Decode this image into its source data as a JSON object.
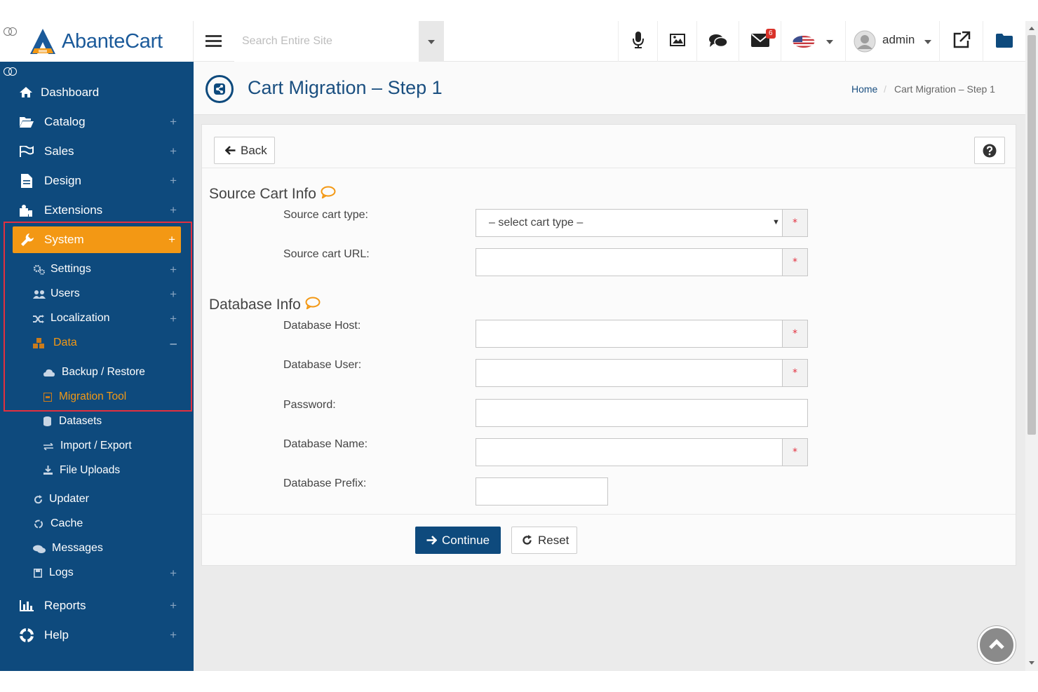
{
  "app": {
    "brand": "AbanteCart"
  },
  "topbar": {
    "search_placeholder": "Search Entire Site",
    "messages_badge": "6",
    "user_name": "admin"
  },
  "sidebar": {
    "items": [
      {
        "label": "Dashboard",
        "icon": "home-icon"
      },
      {
        "label": "Catalog",
        "icon": "folder-open-icon"
      },
      {
        "label": "Sales",
        "icon": "flag-icon"
      },
      {
        "label": "Design",
        "icon": "file-icon"
      },
      {
        "label": "Extensions",
        "icon": "puzzle-icon"
      },
      {
        "label": "System",
        "icon": "wrench-icon"
      }
    ],
    "system_children": [
      {
        "label": "Settings",
        "icon": "cogs-icon"
      },
      {
        "label": "Users",
        "icon": "users-icon"
      },
      {
        "label": "Localization",
        "icon": "random-icon"
      },
      {
        "label": "Data",
        "icon": "cubes-icon"
      }
    ],
    "data_children": [
      {
        "label": "Backup / Restore",
        "icon": "cloud-icon"
      },
      {
        "label": "Migration Tool",
        "icon": "database-icon"
      },
      {
        "label": "Datasets",
        "icon": "datasets-icon"
      },
      {
        "label": "Import / Export",
        "icon": "exchange-icon"
      },
      {
        "label": "File Uploads",
        "icon": "upload-icon"
      }
    ],
    "system_more": [
      {
        "label": "Updater",
        "icon": "refresh-icon"
      },
      {
        "label": "Cache",
        "icon": "recycle-icon"
      },
      {
        "label": "Messages",
        "icon": "comments-icon"
      },
      {
        "label": "Logs",
        "icon": "save-icon"
      }
    ],
    "bottom": [
      {
        "label": "Reports",
        "icon": "bar-chart-icon"
      },
      {
        "label": "Help",
        "icon": "life-ring-icon"
      }
    ],
    "plus": "+",
    "minus": "–"
  },
  "page": {
    "title": "Cart Migration – Step 1",
    "breadcrumb": {
      "home": "Home",
      "sep": "/",
      "current": "Cart Migration – Step 1"
    }
  },
  "form": {
    "back_label": "Back",
    "source_section": "Source Cart Info",
    "db_section": "Database Info",
    "labels": {
      "cart_type": "Source cart type:",
      "cart_url": "Source cart URL:",
      "db_host": "Database Host:",
      "db_user": "Database User:",
      "password": "Password:",
      "db_name": "Database Name:",
      "db_prefix": "Database Prefix:"
    },
    "cart_type_value": "– select cart type –",
    "required_mark": "*",
    "continue_label": "Continue",
    "reset_label": "Reset"
  },
  "colors": {
    "sidebar_bg": "#0e4a7d",
    "accent_orange": "#f39814",
    "highlight_red": "#e3303f",
    "brand_blue": "#1b5a9a"
  }
}
